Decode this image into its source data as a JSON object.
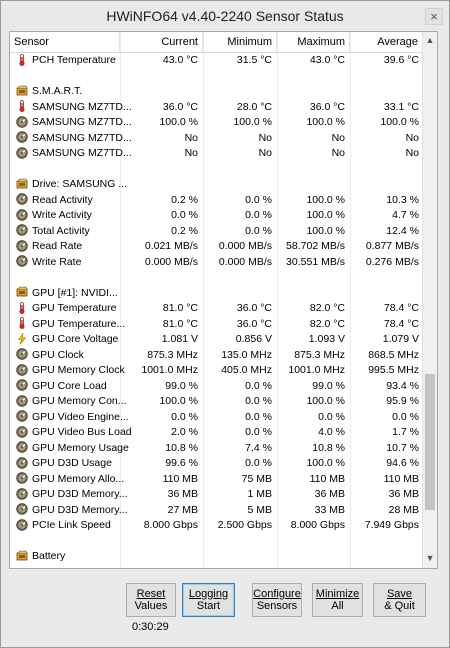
{
  "window": {
    "title": "HWiNFO64 v4.40-2240 Sensor Status",
    "close": "×"
  },
  "header": {
    "sensor": "Sensor",
    "current": "Current",
    "minimum": "Minimum",
    "maximum": "Maximum",
    "average": "Average"
  },
  "rows": [
    {
      "type": "sensor",
      "icon": "thermometer",
      "name": "PCH Temperature",
      "cur": "43.0 °C",
      "min": "31.5 °C",
      "max": "43.0 °C",
      "avg": "39.6 °C"
    },
    {
      "type": "blank"
    },
    {
      "type": "group",
      "icon": "chip",
      "name": "S.M.A.R.T."
    },
    {
      "type": "sensor",
      "icon": "thermometer",
      "name": "SAMSUNG MZ7TD...",
      "cur": "36.0 °C",
      "min": "28.0 °C",
      "max": "36.0 °C",
      "avg": "33.1 °C"
    },
    {
      "type": "sensor",
      "icon": "gauge",
      "name": "SAMSUNG MZ7TD...",
      "cur": "100.0 %",
      "min": "100.0 %",
      "max": "100.0 %",
      "avg": "100.0 %"
    },
    {
      "type": "sensor",
      "icon": "gauge",
      "name": "SAMSUNG MZ7TD...",
      "cur": "No",
      "min": "No",
      "max": "No",
      "avg": "No"
    },
    {
      "type": "sensor",
      "icon": "gauge",
      "name": "SAMSUNG MZ7TD...",
      "cur": "No",
      "min": "No",
      "max": "No",
      "avg": "No"
    },
    {
      "type": "blank"
    },
    {
      "type": "group",
      "icon": "chip",
      "name": "Drive: SAMSUNG ..."
    },
    {
      "type": "sensor",
      "icon": "gauge",
      "name": "Read Activity",
      "cur": "0.2 %",
      "min": "0.0 %",
      "max": "100.0 %",
      "avg": "10.3 %"
    },
    {
      "type": "sensor",
      "icon": "gauge",
      "name": "Write Activity",
      "cur": "0.0 %",
      "min": "0.0 %",
      "max": "100.0 %",
      "avg": "4.7 %"
    },
    {
      "type": "sensor",
      "icon": "gauge",
      "name": "Total Activity",
      "cur": "0.2 %",
      "min": "0.0 %",
      "max": "100.0 %",
      "avg": "12.4 %"
    },
    {
      "type": "sensor",
      "icon": "gauge",
      "name": "Read Rate",
      "cur": "0.021 MB/s",
      "min": "0.000 MB/s",
      "max": "58.702 MB/s",
      "avg": "0.877 MB/s"
    },
    {
      "type": "sensor",
      "icon": "gauge",
      "name": "Write Rate",
      "cur": "0.000 MB/s",
      "min": "0.000 MB/s",
      "max": "30.551 MB/s",
      "avg": "0.276 MB/s"
    },
    {
      "type": "blank"
    },
    {
      "type": "group",
      "icon": "chip",
      "name": "GPU [#1]: NVIDI..."
    },
    {
      "type": "sensor",
      "icon": "thermometer",
      "name": "GPU Temperature",
      "cur": "81.0 °C",
      "min": "36.0 °C",
      "max": "82.0 °C",
      "avg": "78.4 °C"
    },
    {
      "type": "sensor",
      "icon": "thermometer",
      "name": "GPU Temperature...",
      "cur": "81.0 °C",
      "min": "36.0 °C",
      "max": "82.0 °C",
      "avg": "78.4 °C"
    },
    {
      "type": "sensor",
      "icon": "bolt",
      "name": "GPU Core Voltage",
      "cur": "1.081 V",
      "min": "0.856 V",
      "max": "1.093 V",
      "avg": "1.079 V"
    },
    {
      "type": "sensor",
      "icon": "gauge",
      "name": "GPU Clock",
      "cur": "875.3 MHz",
      "min": "135.0 MHz",
      "max": "875.3 MHz",
      "avg": "868.5 MHz"
    },
    {
      "type": "sensor",
      "icon": "gauge",
      "name": "GPU Memory Clock",
      "cur": "1001.0 MHz",
      "min": "405.0 MHz",
      "max": "1001.0 MHz",
      "avg": "995.5 MHz"
    },
    {
      "type": "sensor",
      "icon": "gauge",
      "name": "GPU Core Load",
      "cur": "99.0 %",
      "min": "0.0 %",
      "max": "99.0 %",
      "avg": "93.4 %"
    },
    {
      "type": "sensor",
      "icon": "gauge",
      "name": "GPU Memory Con...",
      "cur": "100.0 %",
      "min": "0.0 %",
      "max": "100.0 %",
      "avg": "95.9 %"
    },
    {
      "type": "sensor",
      "icon": "gauge",
      "name": "GPU Video Engine...",
      "cur": "0.0 %",
      "min": "0.0 %",
      "max": "0.0 %",
      "avg": "0.0 %"
    },
    {
      "type": "sensor",
      "icon": "gauge",
      "name": "GPU Video Bus Load",
      "cur": "2.0 %",
      "min": "0.0 %",
      "max": "4.0 %",
      "avg": "1.7 %"
    },
    {
      "type": "sensor",
      "icon": "gauge",
      "name": "GPU Memory Usage",
      "cur": "10.8 %",
      "min": "7.4 %",
      "max": "10.8 %",
      "avg": "10.7 %"
    },
    {
      "type": "sensor",
      "icon": "gauge",
      "name": "GPU D3D Usage",
      "cur": "99.6 %",
      "min": "0.0 %",
      "max": "100.0 %",
      "avg": "94.6 %"
    },
    {
      "type": "sensor",
      "icon": "gauge",
      "name": "GPU Memory Allo...",
      "cur": "110 MB",
      "min": "75 MB",
      "max": "110 MB",
      "avg": "110 MB"
    },
    {
      "type": "sensor",
      "icon": "gauge",
      "name": "GPU D3D Memory...",
      "cur": "36 MB",
      "min": "1 MB",
      "max": "36 MB",
      "avg": "36 MB"
    },
    {
      "type": "sensor",
      "icon": "gauge",
      "name": "GPU D3D Memory...",
      "cur": "27 MB",
      "min": "5 MB",
      "max": "33 MB",
      "avg": "28 MB"
    },
    {
      "type": "sensor",
      "icon": "gauge",
      "name": "PCIe Link Speed",
      "cur": "8.000 Gbps",
      "min": "2.500 Gbps",
      "max": "8.000 Gbps",
      "avg": "7.949 Gbps"
    },
    {
      "type": "blank"
    },
    {
      "type": "group",
      "icon": "chip",
      "name": "Battery"
    }
  ],
  "buttons": {
    "reset": [
      "Reset",
      "Values"
    ],
    "logging": [
      "Logging",
      "Start"
    ],
    "configure": [
      "Configure",
      "Sensors"
    ],
    "minimize": [
      "Minimize",
      "All"
    ],
    "save": [
      "Save",
      "& Quit"
    ]
  },
  "timer": "0:30:29",
  "scroll": {
    "up": "▲",
    "down": "▼"
  }
}
